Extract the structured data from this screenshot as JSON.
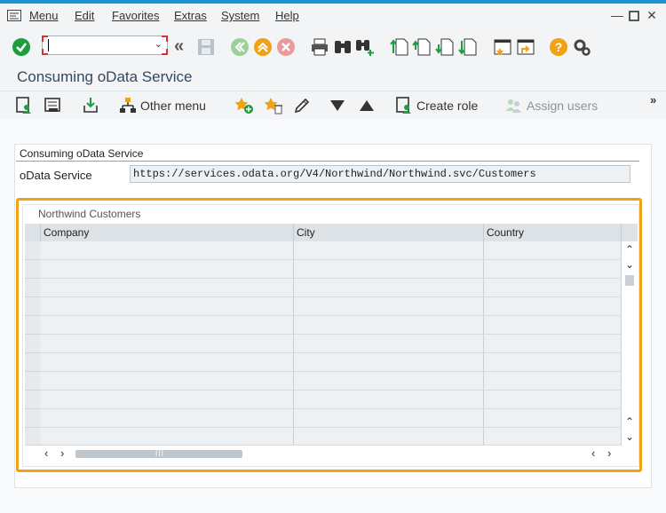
{
  "menubar": {
    "items": [
      {
        "label": "Menu"
      },
      {
        "label": "Edit"
      },
      {
        "label": "Favorites"
      },
      {
        "label": "Extras"
      },
      {
        "label": "System"
      },
      {
        "label": "Help"
      }
    ]
  },
  "toolbar": {
    "command_field_value": ""
  },
  "page": {
    "title": "Consuming oData Service"
  },
  "app_toolbar": {
    "other_menu": "Other menu",
    "create_role": "Create role",
    "assign_users": "Assign users"
  },
  "form": {
    "group_title": "Consuming oData Service",
    "service_label": "oData Service",
    "service_value": "https://services.odata.org/V4/Northwind/Northwind.svc/Customers"
  },
  "table": {
    "title": "Northwind Customers",
    "columns": [
      "Company",
      "City",
      "Country"
    ],
    "rows": [],
    "empty_row_count": 11
  },
  "colors": {
    "accent": "#1b93d1",
    "highlight": "#f0a215",
    "confirm": "#1f9c3e"
  }
}
